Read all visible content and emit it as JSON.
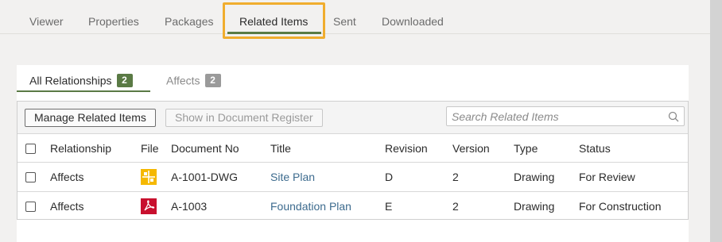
{
  "top_tabs": [
    {
      "label": "Viewer"
    },
    {
      "label": "Properties"
    },
    {
      "label": "Packages"
    },
    {
      "label": "Related Items",
      "active": true
    },
    {
      "label": "Sent"
    },
    {
      "label": "Downloaded"
    }
  ],
  "sub_tabs": [
    {
      "label": "All Relationships",
      "count": "2",
      "active": true
    },
    {
      "label": "Affects",
      "count": "2"
    }
  ],
  "toolbar": {
    "manage_label": "Manage Related Items",
    "register_label": "Show in Document Register",
    "search_placeholder": "Search Related Items"
  },
  "table": {
    "columns": [
      "Relationship",
      "File",
      "Document No",
      "Title",
      "Revision",
      "Version",
      "Type",
      "Status"
    ],
    "rows": [
      {
        "relationship": "Affects",
        "file_icon": "drawing-file-icon",
        "document_no": "A-1001-DWG",
        "title": "Site Plan",
        "revision": "D",
        "version": "2",
        "type": "Drawing",
        "status": "For Review"
      },
      {
        "relationship": "Affects",
        "file_icon": "pdf-file-icon",
        "document_no": "A-1003",
        "title": "Foundation Plan",
        "revision": "E",
        "version": "2",
        "type": "Drawing",
        "status": "For Construction"
      }
    ]
  },
  "colors": {
    "accent_green": "#5a7a45",
    "highlight_orange": "#f0ad2e",
    "link_blue": "#3d6b8e",
    "drawing_icon_yellow": "#f5b800",
    "pdf_icon_red": "#c8102e"
  }
}
